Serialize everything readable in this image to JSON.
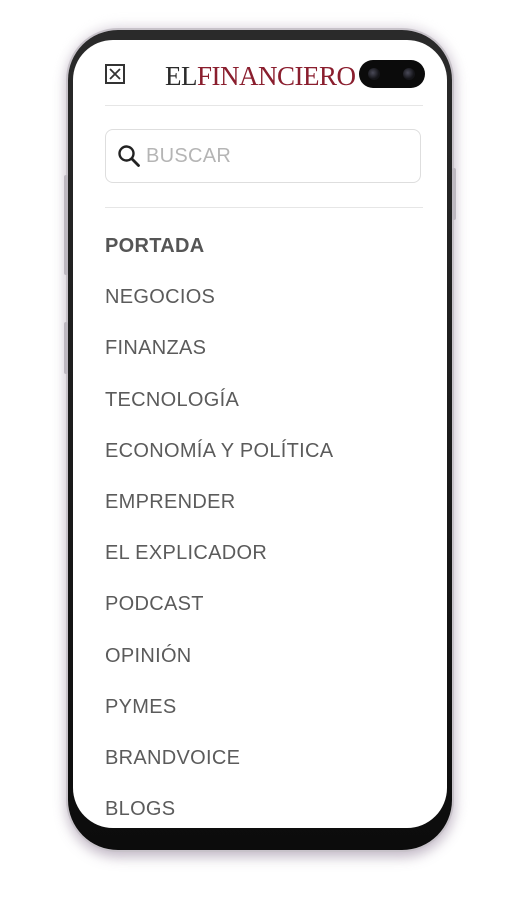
{
  "header": {
    "logo_el": "EL",
    "logo_financiero": "FINANCIERO",
    "close_icon": "close-icon"
  },
  "search": {
    "placeholder": "BUSCAR",
    "icon": "search-icon"
  },
  "menu": {
    "active_index": 0,
    "items": [
      {
        "label": "PORTADA"
      },
      {
        "label": "NEGOCIOS"
      },
      {
        "label": "FINANZAS"
      },
      {
        "label": "TECNOLOGÍA"
      },
      {
        "label": "ECONOMÍA Y POLÍTICA"
      },
      {
        "label": "EMPRENDER"
      },
      {
        "label": "EL EXPLICADOR"
      },
      {
        "label": "PODCAST"
      },
      {
        "label": "OPINIÓN"
      },
      {
        "label": "PYMES"
      },
      {
        "label": "BRANDVOICE"
      },
      {
        "label": "BLOGS"
      }
    ]
  },
  "colors": {
    "brand_red": "#8a1e2e",
    "menu_text": "#5b5b5b",
    "placeholder": "#b5b5b5"
  }
}
